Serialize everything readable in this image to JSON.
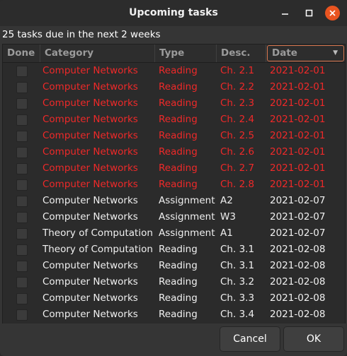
{
  "window": {
    "title": "Upcoming tasks",
    "colors": {
      "close": "#e95420",
      "overdue": "#ef2929",
      "accent": "#d8764f"
    }
  },
  "summary": "25 tasks due in the next 2 weeks",
  "table": {
    "columns": [
      "Done",
      "Category",
      "Type",
      "Desc.",
      "Date"
    ],
    "sorted_by": "Date",
    "rows": [
      {
        "done": false,
        "overdue": true,
        "category": "Computer Networks",
        "type": "Reading",
        "desc": "Ch. 2.1",
        "date": "2021-02-01"
      },
      {
        "done": false,
        "overdue": true,
        "category": "Computer Networks",
        "type": "Reading",
        "desc": "Ch. 2.2",
        "date": "2021-02-01"
      },
      {
        "done": false,
        "overdue": true,
        "category": "Computer Networks",
        "type": "Reading",
        "desc": "Ch. 2.3",
        "date": "2021-02-01"
      },
      {
        "done": false,
        "overdue": true,
        "category": "Computer Networks",
        "type": "Reading",
        "desc": "Ch. 2.4",
        "date": "2021-02-01"
      },
      {
        "done": false,
        "overdue": true,
        "category": "Computer Networks",
        "type": "Reading",
        "desc": "Ch. 2.5",
        "date": "2021-02-01"
      },
      {
        "done": false,
        "overdue": true,
        "category": "Computer Networks",
        "type": "Reading",
        "desc": "Ch. 2.6",
        "date": "2021-02-01"
      },
      {
        "done": false,
        "overdue": true,
        "category": "Computer Networks",
        "type": "Reading",
        "desc": "Ch. 2.7",
        "date": "2021-02-01"
      },
      {
        "done": false,
        "overdue": true,
        "category": "Computer Networks",
        "type": "Reading",
        "desc": "Ch. 2.8",
        "date": "2021-02-01"
      },
      {
        "done": false,
        "overdue": false,
        "category": "Computer Networks",
        "type": "Assignment",
        "desc": "A2",
        "date": "2021-02-07"
      },
      {
        "done": false,
        "overdue": false,
        "category": "Computer Networks",
        "type": "Assignment",
        "desc": "W3",
        "date": "2021-02-07"
      },
      {
        "done": false,
        "overdue": false,
        "category": "Theory of Computation",
        "type": "Assignment",
        "desc": "A1",
        "date": "2021-02-07"
      },
      {
        "done": false,
        "overdue": false,
        "category": "Theory of Computation",
        "type": "Reading",
        "desc": "Ch. 3.1",
        "date": "2021-02-08"
      },
      {
        "done": false,
        "overdue": false,
        "category": "Computer Networks",
        "type": "Reading",
        "desc": "Ch. 3.1",
        "date": "2021-02-08"
      },
      {
        "done": false,
        "overdue": false,
        "category": "Computer Networks",
        "type": "Reading",
        "desc": "Ch. 3.2",
        "date": "2021-02-08"
      },
      {
        "done": false,
        "overdue": false,
        "category": "Computer Networks",
        "type": "Reading",
        "desc": "Ch. 3.3",
        "date": "2021-02-08"
      },
      {
        "done": false,
        "overdue": false,
        "category": "Computer Networks",
        "type": "Reading",
        "desc": "Ch. 3.4",
        "date": "2021-02-08"
      }
    ]
  },
  "buttons": {
    "cancel": "Cancel",
    "ok": "OK"
  }
}
